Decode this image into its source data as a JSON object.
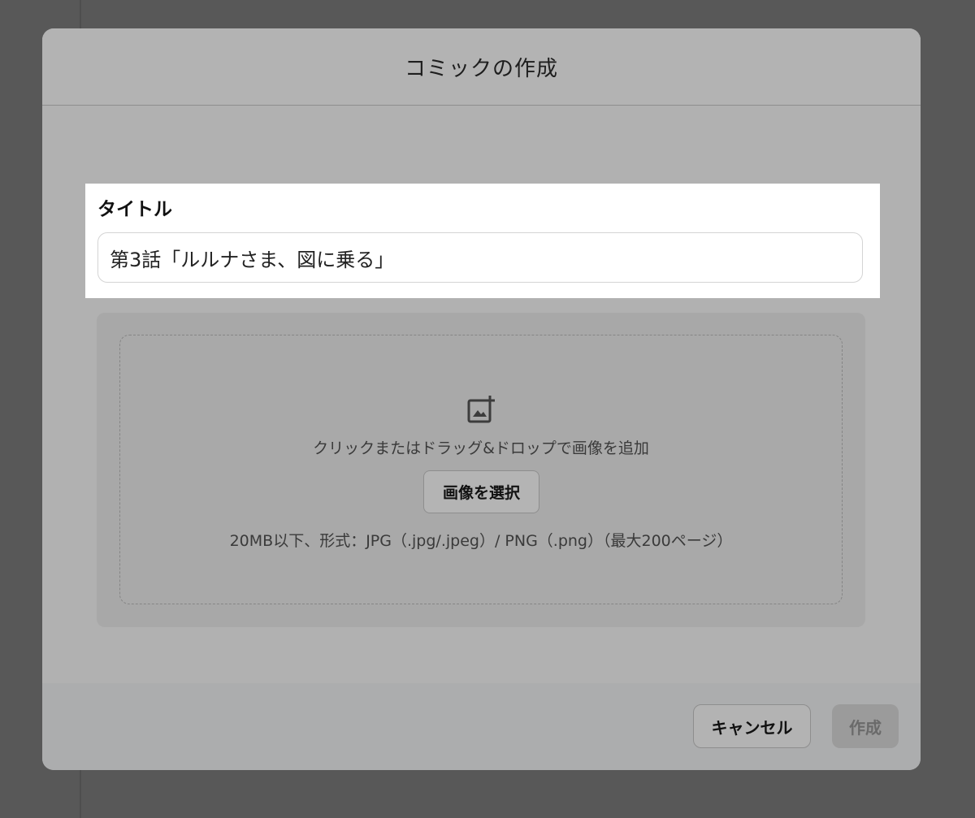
{
  "dialog": {
    "title": "コミックの作成"
  },
  "form": {
    "title_label": "タイトル",
    "title_value": "第3話「ルルナさま、図に乗る」"
  },
  "upload": {
    "icon": "add-photo-icon",
    "hint": "クリックまたはドラッグ&ドロップで画像を追加",
    "select_label": "画像を選択",
    "format_note": "20MB以下、形式：JPG（.jpg/.jpeg）/ PNG（.png）（最大200ページ）"
  },
  "footer": {
    "cancel_label": "キャンセル",
    "create_label": "作成"
  },
  "colors": {
    "overlay": "#585858",
    "modal_bg": "#b2b2b2",
    "highlight": "#ffffff"
  }
}
